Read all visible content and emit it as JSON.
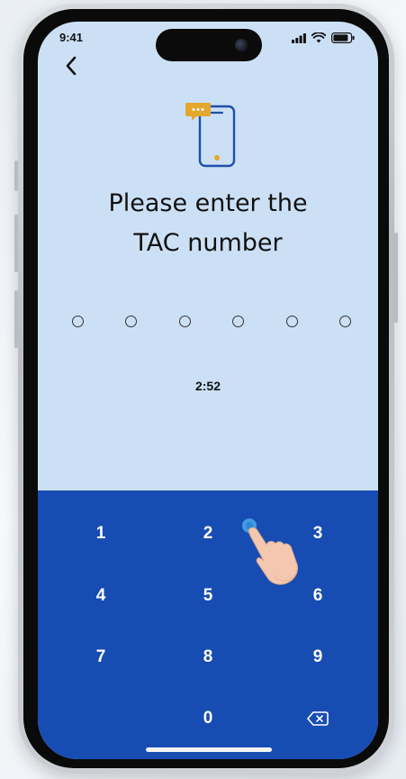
{
  "status_bar": {
    "time": "9:41"
  },
  "nav": {
    "back_icon": "chevron-left-icon"
  },
  "hero": {
    "icon": "phone-message-icon"
  },
  "title": {
    "line1": "Please enter the",
    "line2": "TAC number"
  },
  "pin": {
    "length": 6,
    "filled": 0
  },
  "timer": "2:52",
  "keypad": {
    "keys": [
      {
        "label": "1"
      },
      {
        "label": "2"
      },
      {
        "label": "3"
      },
      {
        "label": "4"
      },
      {
        "label": "5"
      },
      {
        "label": "6"
      },
      {
        "label": "7"
      },
      {
        "label": "8"
      },
      {
        "label": "9"
      },
      {
        "label": "0"
      }
    ],
    "backspace_icon": "backspace-icon"
  },
  "colors": {
    "screen_bg": "#cce0f5",
    "keypad_bg": "#174db3",
    "accent_yellow": "#e3a72b",
    "icon_blue": "#1f4fa8"
  }
}
